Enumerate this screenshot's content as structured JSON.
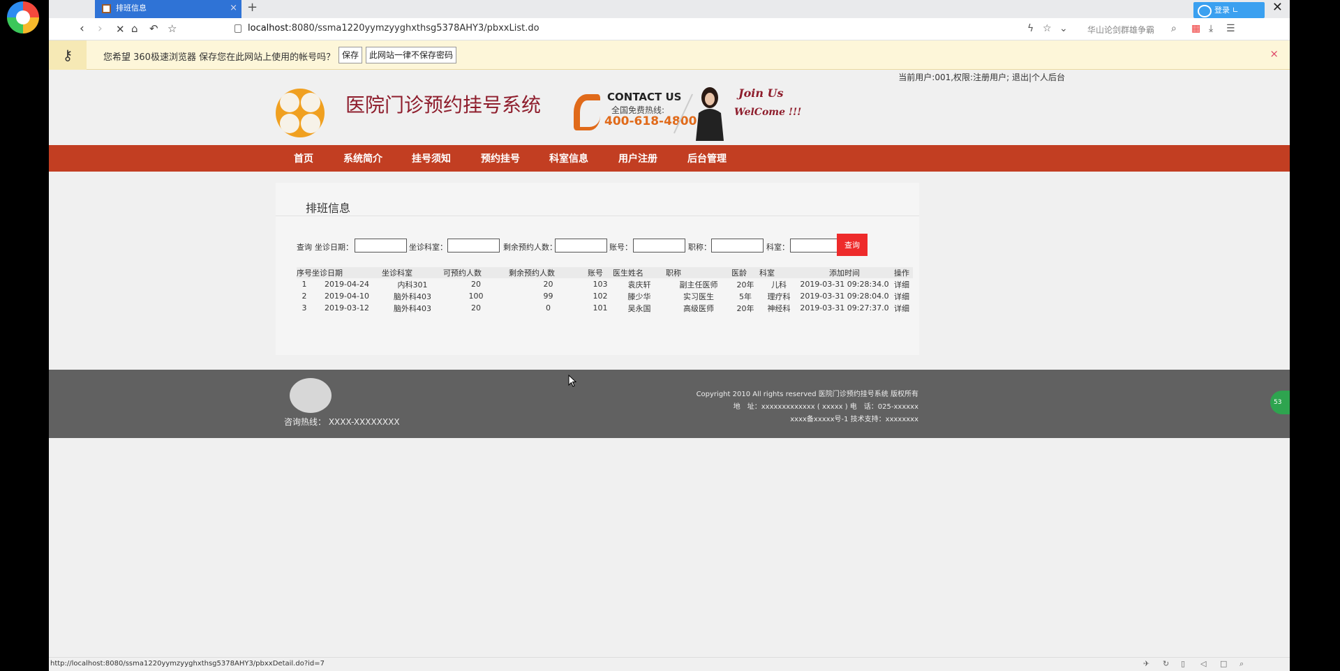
{
  "browser": {
    "tab_title": "排班信息",
    "new_tab": "+",
    "url_host": "localhost",
    "url_rest": ":8080/ssma1220yymzyyghxthsg5378AHY3/pbxxList.do",
    "search_hint": "华山论剑群雄争霸",
    "login_label": "登录 ∟",
    "icons": [
      "back-icon",
      "forward-icon",
      "stop-icon",
      "home-icon",
      "undo-icon",
      "star-icon"
    ]
  },
  "password_bar": {
    "message": "您希望 360极速浏览器 保存您在此网站上使用的帐号吗？",
    "save_label": "保存",
    "never_label": "此网站一律不保存密码",
    "close_label": "×"
  },
  "page": {
    "user_info": "当前用户:001,权限:注册用户; 退出|个人后台",
    "site_title": "医院门诊预约挂号系统",
    "contact_en": "CONTACT US",
    "contact_zh": "全国免费热线:",
    "contact_number": "400-618-4800",
    "join": "Join Us",
    "welcome": "WelCome !!!",
    "nav": [
      "首页",
      "系统简介",
      "挂号须知",
      "预约挂号",
      "科室信息",
      "用户注册",
      "后台管理"
    ],
    "panel_title": "排班信息",
    "filters": {
      "query_prefix": "查询",
      "date": "坐诊日期：",
      "room": "坐诊科室：",
      "remaining": "剩余预约人数：",
      "account": "账号：",
      "title": "职称：",
      "dept": "科室：",
      "button": "查询"
    },
    "table": {
      "headers": [
        "序号",
        "坐诊日期",
        "坐诊科室",
        "可预约人数",
        "剩余预约人数",
        "账号",
        "医生姓名",
        "职称",
        "医龄",
        "科室",
        "添加时间",
        "操作"
      ],
      "rows": [
        [
          "1",
          "2019-04-24",
          "内科301",
          "20",
          "20",
          "103",
          "袁庆轩",
          "副主任医师",
          "20年",
          "儿科",
          "2019-03-31 09:28:34.0",
          "详细"
        ],
        [
          "2",
          "2019-04-10",
          "脑外科403",
          "100",
          "99",
          "102",
          "滕少华",
          "实习医生",
          "5年",
          "理疗科",
          "2019-03-31 09:28:04.0",
          "详细"
        ],
        [
          "3",
          "2019-03-12",
          "脑外科403",
          "20",
          "0",
          "101",
          "吴永国",
          "高级医师",
          "20年",
          "神经科",
          "2019-03-31 09:27:37.0",
          "详细"
        ]
      ]
    }
  },
  "footer": {
    "hotline": "咨询热线： XXXX-XXXXXXXX",
    "copyright": "Copyright 2010 All rights reserved 医院门诊预约挂号系统 版权所有",
    "address": "地　址：xxxxxxxxxxxxx ( xxxxx ) 电　话：025-xxxxxx",
    "icp": "xxxx备xxxxx号-1 技术支持：xxxxxxxx",
    "side_badge": "53"
  },
  "status_bar": {
    "url": "http://localhost:8080/ssma1220yymzyyghxthsg5378AHY3/pbxxDetail.do?id=7"
  }
}
